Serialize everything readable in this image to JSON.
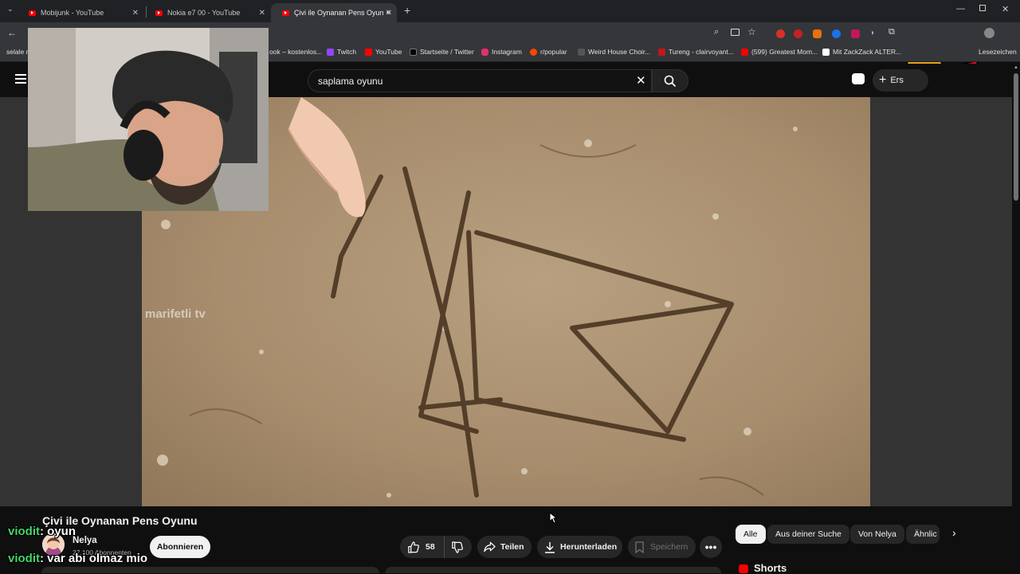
{
  "browser": {
    "tabs": [
      {
        "title": "Mobijunk - YouTube"
      },
      {
        "title": "Nokia e7 00 - YouTube"
      },
      {
        "title": "Çivi ile Oynanan Pens Oyun"
      }
    ],
    "new_tab_symbol": "+",
    "bookmarks": [
      {
        "label": "selale m",
        "color": "#35363a"
      },
      {
        "label": "ook – kostenlos...",
        "color": "#35363a"
      },
      {
        "label": "Twitch",
        "color": "#9146ff"
      },
      {
        "label": "YouTube",
        "color": "#ff0000"
      },
      {
        "label": "Startseite / Twitter",
        "color": "#000000"
      },
      {
        "label": "Instagram",
        "color": "#e1306c"
      },
      {
        "label": "r/popular",
        "color": "#ff4500"
      },
      {
        "label": "Weird House Choir...",
        "color": "#333333"
      },
      {
        "label": "Tureng - clairvoyant...",
        "color": "#c4161c"
      },
      {
        "label": "(599) Greatest Mom...",
        "color": "#ff0000"
      },
      {
        "label": "Mit ZackZack ALTER...",
        "color": "#ffffff"
      },
      {
        "label": "Lesezeichen",
        "color": "#35363a"
      }
    ]
  },
  "youtube": {
    "search_value": "saplama oyunu",
    "create_label": "Ers",
    "video_watermark": "marifetli tv",
    "video_title": "Çivi ile Oynanan Pens Oyunu",
    "channel_name": "Nelya",
    "subscribers": "27.100 Abonnenten",
    "subscribe_label": "Abonnieren",
    "likes": "58",
    "share_label": "Teilen",
    "download_label": "Herunterladen",
    "save_label": "Speichern",
    "chips": [
      "Alle",
      "Aus deiner Suche",
      "Von Nelya",
      "Ähnlic"
    ],
    "shorts_label": "Shorts"
  },
  "chat": [
    {
      "user": "viodit",
      "message": ": oyun"
    },
    {
      "user": "viodit",
      "message": ": var abi olmaz mio"
    }
  ],
  "colors": {
    "accent": "#ff0000",
    "chat_user": "#45d56b"
  }
}
